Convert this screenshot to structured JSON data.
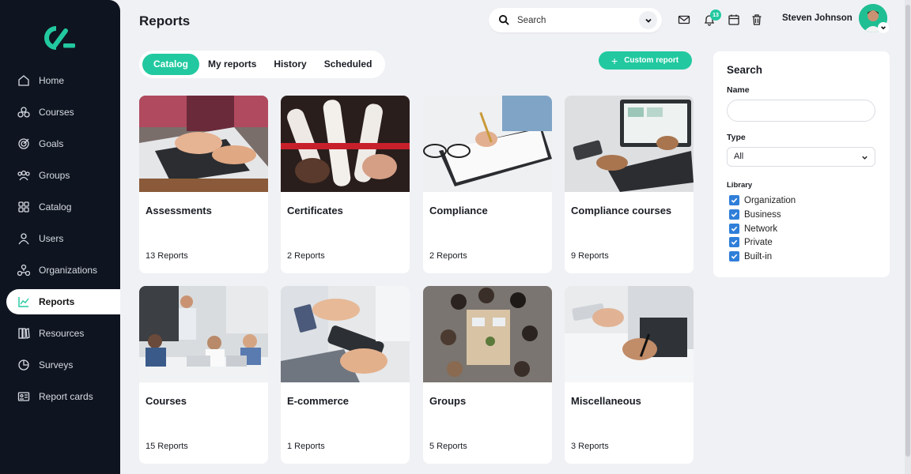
{
  "app": {
    "title": "Reports"
  },
  "nav": [
    {
      "label": "Home",
      "icon": "home-icon"
    },
    {
      "label": "Courses",
      "icon": "courses-icon"
    },
    {
      "label": "Goals",
      "icon": "goals-icon"
    },
    {
      "label": "Groups",
      "icon": "groups-icon"
    },
    {
      "label": "Catalog",
      "icon": "catalog-icon"
    },
    {
      "label": "Users",
      "icon": "users-icon"
    },
    {
      "label": "Organizations",
      "icon": "organizations-icon"
    },
    {
      "label": "Reports",
      "icon": "reports-icon",
      "active": true
    },
    {
      "label": "Resources",
      "icon": "resources-icon"
    },
    {
      "label": "Surveys",
      "icon": "surveys-icon"
    },
    {
      "label": "Report cards",
      "icon": "report-cards-icon"
    }
  ],
  "header": {
    "search_placeholder": "Search",
    "notification_count": "13",
    "user_name": "Steven Johnson"
  },
  "tabs": [
    "Catalog",
    "My reports",
    "History",
    "Scheduled"
  ],
  "custom_report_label": "Custom report",
  "cards": [
    {
      "title": "Assessments",
      "count": "13 Reports"
    },
    {
      "title": "Certificates",
      "count": "2 Reports"
    },
    {
      "title": "Compliance",
      "count": "2 Reports"
    },
    {
      "title": "Compliance courses",
      "count": "9 Reports"
    },
    {
      "title": "Courses",
      "count": "15 Reports"
    },
    {
      "title": "E-commerce",
      "count": "1 Reports"
    },
    {
      "title": "Groups",
      "count": "5 Reports"
    },
    {
      "title": "Miscellaneous",
      "count": "3 Reports"
    }
  ],
  "filter": {
    "heading": "Search",
    "name_label": "Name",
    "type_label": "Type",
    "type_value": "All",
    "library_label": "Library",
    "library": [
      "Organization",
      "Business",
      "Network",
      "Private",
      "Built-in"
    ]
  },
  "colors": {
    "accent": "#22c9a0",
    "sidebar": "#0f1520",
    "checkbox": "#2f7fd9"
  }
}
